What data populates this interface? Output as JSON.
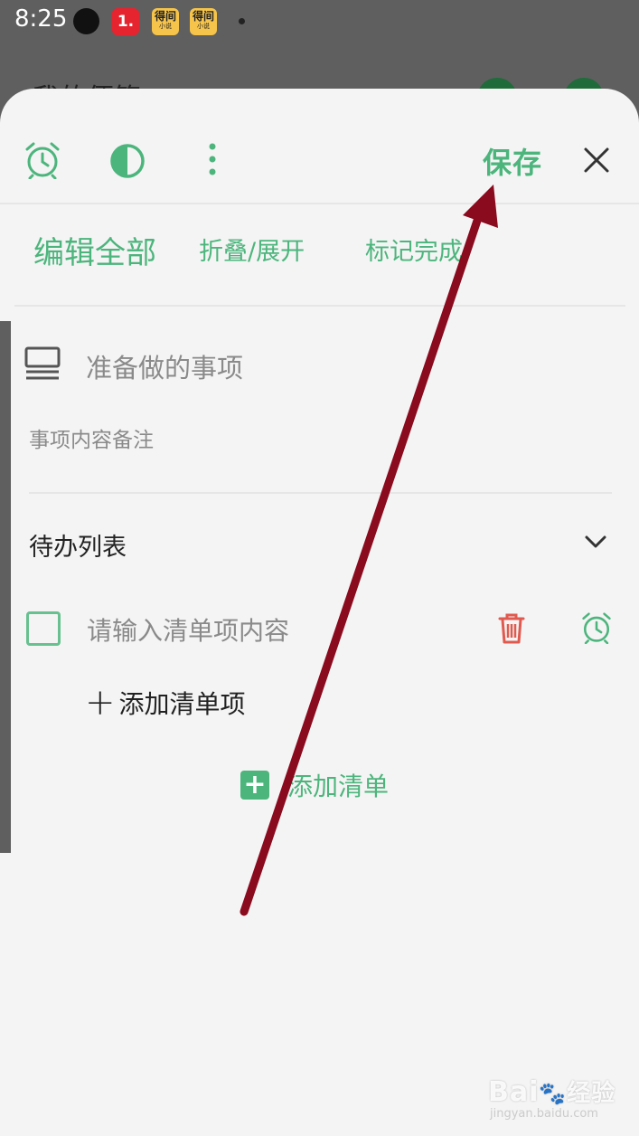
{
  "status_bar": {
    "time": "8:25",
    "icons": [
      "notification-dot-icon",
      "app-1-icon",
      "novel-app-icon",
      "novel-app-icon",
      "small-dot-icon"
    ],
    "app1_label": "1.",
    "novel_label": "得间",
    "novel_sub": "小说"
  },
  "background_app": {
    "title": "我的便签"
  },
  "sheet": {
    "toolbar": {
      "icons": [
        "alarm-icon",
        "contrast-icon",
        "more-vert-icon"
      ],
      "save_label": "保存",
      "close_icon": "close-icon"
    },
    "actions": {
      "edit_all": "编辑全部",
      "fold_expand": "折叠/展开",
      "mark_done": "标记完成"
    },
    "title_placeholder": "准备做的事项",
    "note_placeholder": "事项内容备注",
    "checklist": {
      "title": "待办列表",
      "item_placeholder": "请输入清单项内容",
      "add_item_label": "添加清单项",
      "add_list_label": "添加清单"
    }
  },
  "watermark": {
    "brand": "Bai",
    "brand_cn": "经验",
    "site": "jingyan.baidu.com"
  },
  "colors": {
    "accent": "#4cb57c",
    "delete": "#e05a4f",
    "annotation_arrow": "#8a0a1e"
  }
}
